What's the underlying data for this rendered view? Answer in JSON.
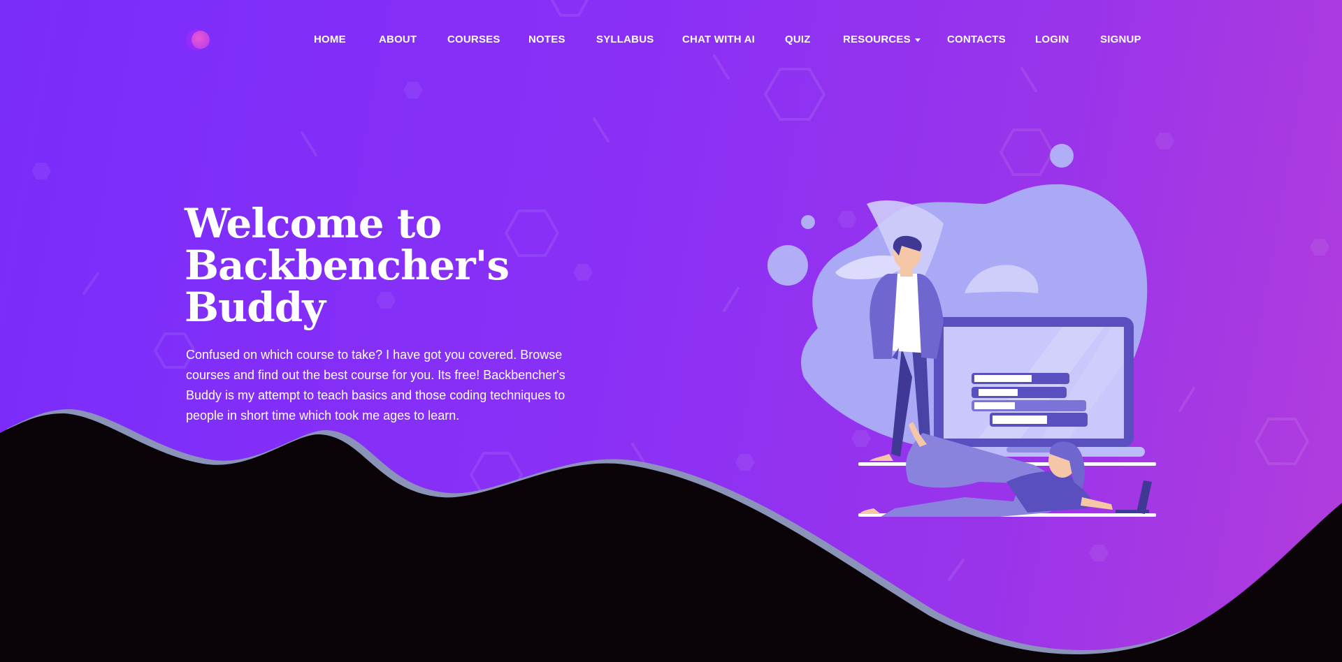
{
  "nav": {
    "items": [
      {
        "label": "HOME"
      },
      {
        "label": "ABOUT"
      },
      {
        "label": "COURSES"
      },
      {
        "label": "NOTES"
      },
      {
        "label": "SYLLABUS"
      },
      {
        "label": "CHAT WITH AI"
      },
      {
        "label": "QUIZ"
      },
      {
        "label": "RESOURCES",
        "dropdown": true
      },
      {
        "label": "CONTACTS"
      },
      {
        "label": "LOGIN"
      },
      {
        "label": "SIGNUP"
      }
    ]
  },
  "hero": {
    "title_lines": [
      "Welcome to",
      "Backbencher's",
      "Buddy"
    ],
    "description": "Confused on which course to take? I have got you covered. Browse courses and find out the best course for you. Its free! Backbencher's Buddy is my attempt to teach basics and those coding techniques to people in short time which took me ages to learn."
  },
  "colors": {
    "gradient_start": "#7a2cfb",
    "gradient_end": "#b23ddc",
    "wave_dark": "#0a0408",
    "wave_edge": "#8b93b8",
    "illustration_primary": "#5a4fbf",
    "illustration_light": "#a7a6f5"
  },
  "icons": {
    "logo": "logo-circles-icon",
    "dropdown": "caret-down-icon"
  }
}
